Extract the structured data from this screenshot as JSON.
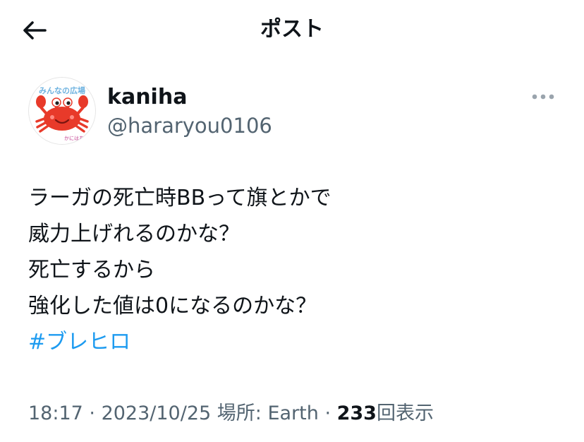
{
  "header": {
    "title": "ポスト",
    "back_icon": "arrow-left-icon"
  },
  "author": {
    "display_name": "kaniha",
    "handle": "@hararyou0106",
    "avatar": {
      "text_top": "みんなの広場",
      "text_bottom": "かにはあ",
      "icon": "crab-icon",
      "colors": {
        "crab": "#e83a2a",
        "text_top": "#6fb3e0",
        "text_bottom": "#c23b8f"
      }
    }
  },
  "more_icon": "more-horizontal-icon",
  "tweet": {
    "lines": [
      "ラーガの死亡時BBって旗とかで",
      "威力上げれるのかな？",
      "死亡するから",
      "強化した値は0になるのかな？"
    ],
    "hashtag": "#ブレヒロ"
  },
  "meta": {
    "time": "18:17",
    "sep1": " · ",
    "date": "2023/10/25",
    "location_label": " 場所: ",
    "location": "Earth",
    "sep2": " · ",
    "views_count": "233",
    "views_label": "回表示"
  },
  "colors": {
    "text": "#0f1419",
    "secondary": "#536471",
    "link": "#1d9bf0"
  }
}
